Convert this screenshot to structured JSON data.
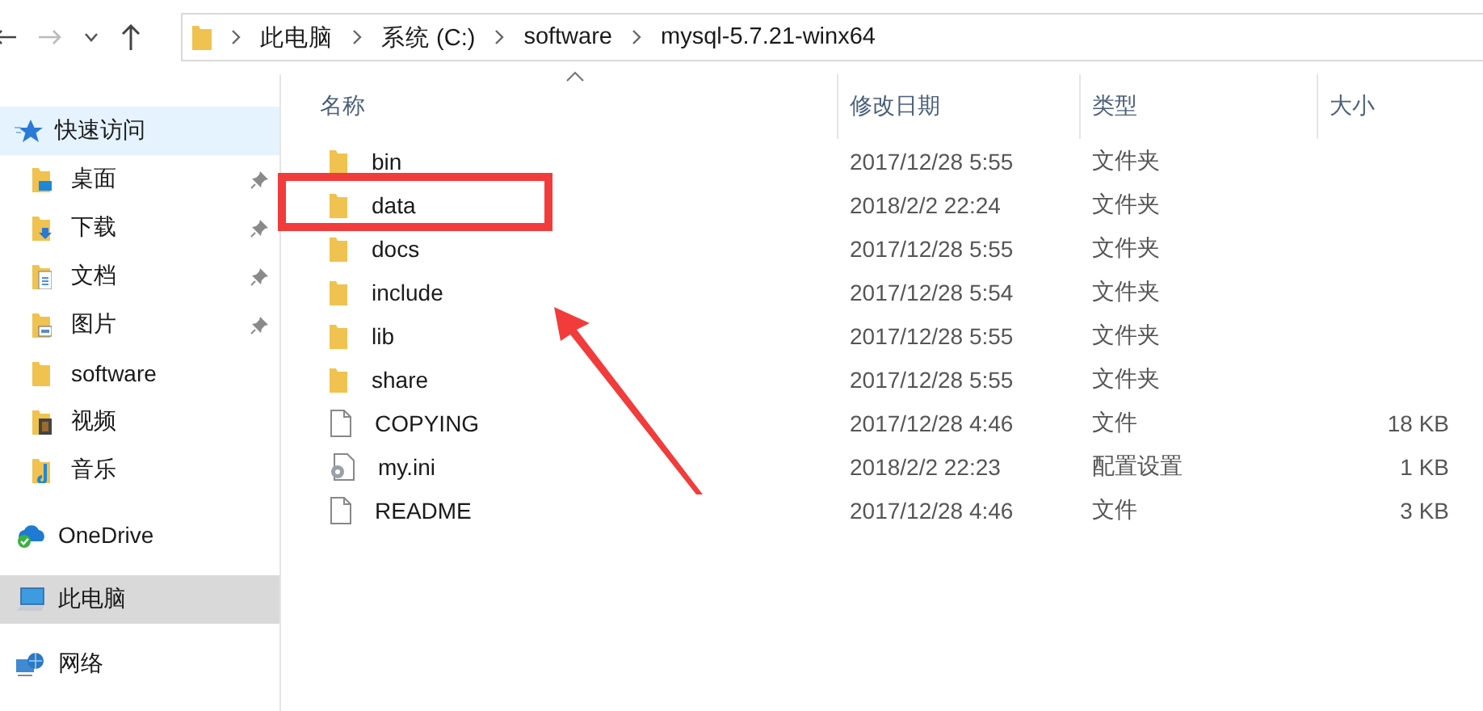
{
  "address_bar": {
    "segments": [
      "此电脑",
      "系统 (C:)",
      "software",
      "mysql-5.7.21-winx64"
    ]
  },
  "sidebar": {
    "items": [
      {
        "label": "快速访问",
        "kind": "quick",
        "pinned": false,
        "hovered": true,
        "selected": false,
        "children": [
          {
            "label": "桌面",
            "kind": "desktop",
            "pinned": true,
            "hovered": false,
            "selected": false
          },
          {
            "label": "下载",
            "kind": "download",
            "pinned": true,
            "hovered": false,
            "selected": false
          },
          {
            "label": "文档",
            "kind": "documents",
            "pinned": true,
            "hovered": false,
            "selected": false
          },
          {
            "label": "图片",
            "kind": "pictures",
            "pinned": true,
            "hovered": false,
            "selected": false
          },
          {
            "label": "software",
            "kind": "folder",
            "pinned": false,
            "hovered": false,
            "selected": false
          },
          {
            "label": "视频",
            "kind": "videos",
            "pinned": false,
            "hovered": false,
            "selected": false
          },
          {
            "label": "音乐",
            "kind": "music",
            "pinned": false,
            "hovered": false,
            "selected": false
          }
        ]
      },
      {
        "label": "OneDrive",
        "kind": "cloud",
        "pinned": false,
        "hovered": false,
        "selected": false
      },
      {
        "label": "此电脑",
        "kind": "pc",
        "pinned": false,
        "hovered": false,
        "selected": true
      },
      {
        "label": "网络",
        "kind": "network",
        "pinned": false,
        "hovered": false,
        "selected": false
      }
    ]
  },
  "table": {
    "columns": [
      "名称",
      "修改日期",
      "类型",
      "大小"
    ],
    "rows": [
      {
        "kind": "folder",
        "name": "bin",
        "date": "2017/12/28 5:55",
        "type": "文件夹",
        "annotated": false
      },
      {
        "kind": "folder",
        "name": "data",
        "date": "2018/2/2 22:24",
        "type": "文件夹",
        "annotated": true
      },
      {
        "kind": "folder",
        "name": "docs",
        "date": "2017/12/28 5:55",
        "type": "文件夹",
        "annotated": false
      },
      {
        "kind": "folder",
        "name": "include",
        "date": "2017/12/28 5:54",
        "type": "文件夹",
        "annotated": false
      },
      {
        "kind": "folder",
        "name": "lib",
        "date": "2017/12/28 5:55",
        "type": "文件夹",
        "annotated": false
      },
      {
        "kind": "folder",
        "name": "share",
        "date": "2017/12/28 5:55",
        "type": "文件夹",
        "annotated": false
      },
      {
        "kind": "file",
        "name": "COPYING",
        "date": "2017/12/28 4:46",
        "type": "文件",
        "size": "18 KB",
        "annotated": false
      },
      {
        "kind": "settings",
        "name": "my.ini",
        "date": "2018/2/2 22:23",
        "type": "配置设置",
        "size": "1 KB",
        "annotated": false
      },
      {
        "kind": "file",
        "name": "README",
        "date": "2017/12/28 4:46",
        "type": "文件",
        "size": "3 KB",
        "annotated": false
      }
    ]
  }
}
